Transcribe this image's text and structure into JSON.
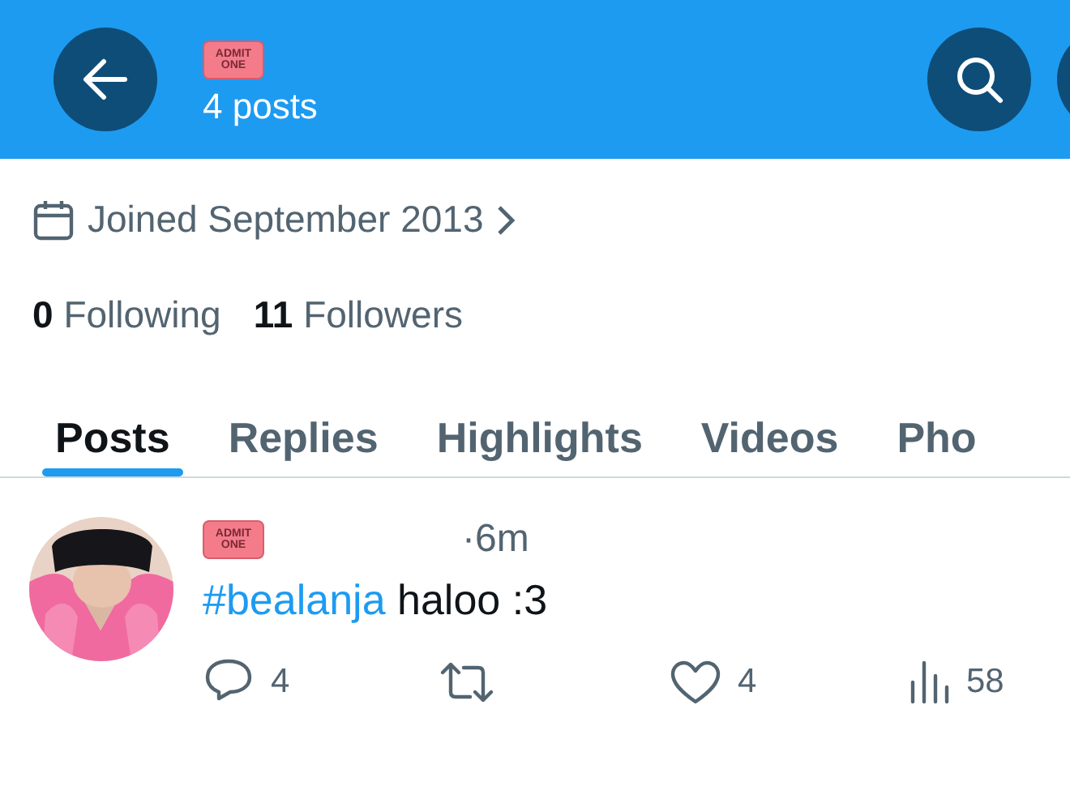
{
  "header": {
    "ticket": [
      "ADMIT",
      "ONE"
    ],
    "post_count": "4 posts"
  },
  "profile": {
    "joined": "Joined September 2013",
    "following_count": "0",
    "following_label": "Following",
    "followers_count": "11",
    "followers_label": "Followers"
  },
  "tabs": [
    {
      "label": "Posts",
      "selected": true
    },
    {
      "label": "Replies",
      "selected": false
    },
    {
      "label": "Highlights",
      "selected": false
    },
    {
      "label": "Videos",
      "selected": false
    },
    {
      "label": "Pho",
      "selected": false
    }
  ],
  "post": {
    "ticket": [
      "ADMIT",
      "ONE"
    ],
    "time": "·6m",
    "hashtag": "#bealanja",
    "text": "haloo :3",
    "actions": [
      {
        "kind": "reply",
        "count": "4"
      },
      {
        "kind": "repost"
      },
      {
        "kind": "like",
        "count": "4"
      },
      {
        "kind": "views",
        "count": "58"
      }
    ]
  }
}
